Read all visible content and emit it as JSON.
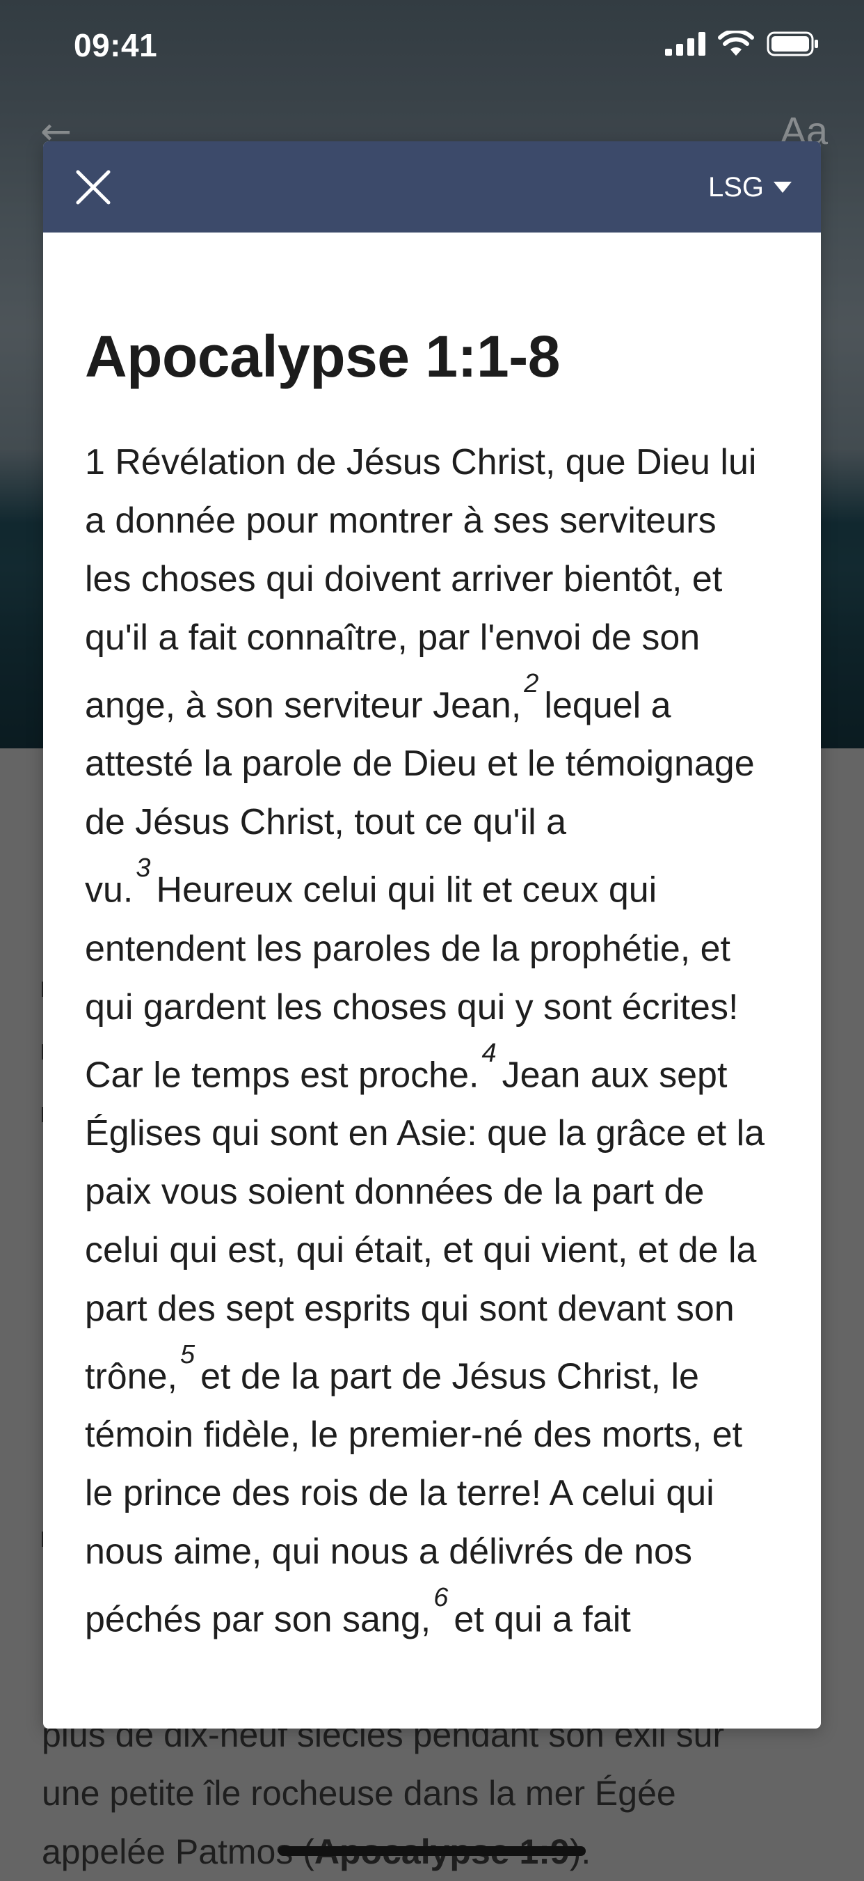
{
  "status_bar": {
    "time": "09:41"
  },
  "background": {
    "article_lines": [
      "plus de dix-neuf siècles pendant son exil sur",
      "une petite île rocheuse dans la mer Égée"
    ],
    "last_line_prefix": "appelée Patmos (",
    "last_line_ref": "Apocalypse 1:9",
    "last_line_suffix": ")."
  },
  "modal": {
    "version_label": "LSG",
    "title": "Apocalypse 1:1-8",
    "verses": [
      {
        "num": "1",
        "text": "Révélation de Jésus Christ, que Dieu lui a donnée pour montrer à ses serviteurs les choses qui doivent arriver bientôt, et qu'il a fait connaître, par l'envoi de son ange, à son serviteur Jean,"
      },
      {
        "num": "2",
        "text": "lequel a attesté la parole de Dieu et le témoignage de Jésus Christ, tout ce qu'il a vu."
      },
      {
        "num": "3",
        "text": "Heureux celui qui lit et ceux qui entendent les paroles de la prophétie, et qui gardent les choses qui y sont écrites! Car le temps est proche."
      },
      {
        "num": "4",
        "text": "Jean aux sept Églises qui sont en Asie: que la grâce et la paix vous soient données de la part de celui qui est, qui était, et qui vient, et de la part des sept esprits qui sont devant son trône,"
      },
      {
        "num": "5",
        "text": "et de la part de Jésus Christ, le témoin fidèle, le premier-né des morts, et le prince des rois de la terre! A celui qui nous aime, qui nous a délivrés de nos péchés par son sang,"
      },
      {
        "num": "6",
        "text": "et qui a fait"
      }
    ]
  }
}
